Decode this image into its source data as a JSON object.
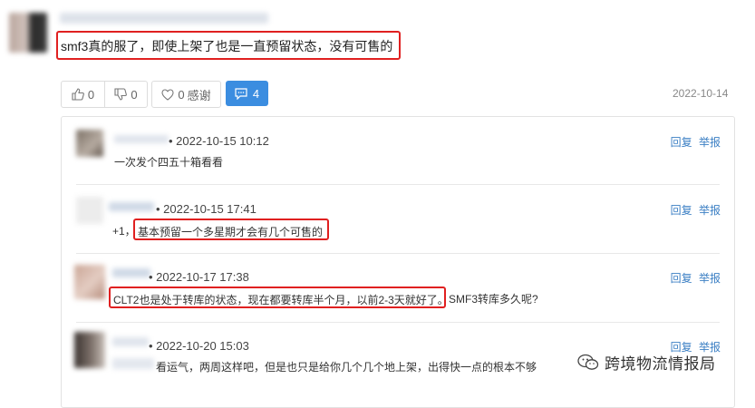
{
  "main_comment": {
    "text": "smf3真的服了，即使上架了也是一直预留状态，没有可售的",
    "date": "2022-10-14"
  },
  "actions": {
    "like_count": "0",
    "dislike_count": "0",
    "thanks_count": "0",
    "thanks_label": "感谢",
    "reply_count": "4"
  },
  "replies": [
    {
      "time": "2022-10-15 10:12",
      "text": "一次发个四五十箱看看",
      "reply_label": "回复",
      "report_label": "举报"
    },
    {
      "time": "2022-10-15 17:41",
      "prefix": "+1，",
      "text": "基本预留一个多星期才会有几个可售的",
      "reply_label": "回复",
      "report_label": "举报"
    },
    {
      "time": "2022-10-17 17:38",
      "text": "CLT2也是处于转库的状态，现在都要转库半个月，以前2-3天就好了。",
      "suffix": "SMF3转库多久呢?",
      "reply_label": "回复",
      "report_label": "举报"
    },
    {
      "time": "2022-10-20 15:03",
      "text": "看运气，两周这样吧，但是也只是给你几个几个地上架，出得快一点的根本不够",
      "reply_label": "回复",
      "report_label": "举报"
    }
  ],
  "watermark": {
    "text": "跨境物流情报局"
  },
  "colors": {
    "highlight": "#e02020",
    "accent": "#3b8de0",
    "link": "#3b7fc4"
  }
}
